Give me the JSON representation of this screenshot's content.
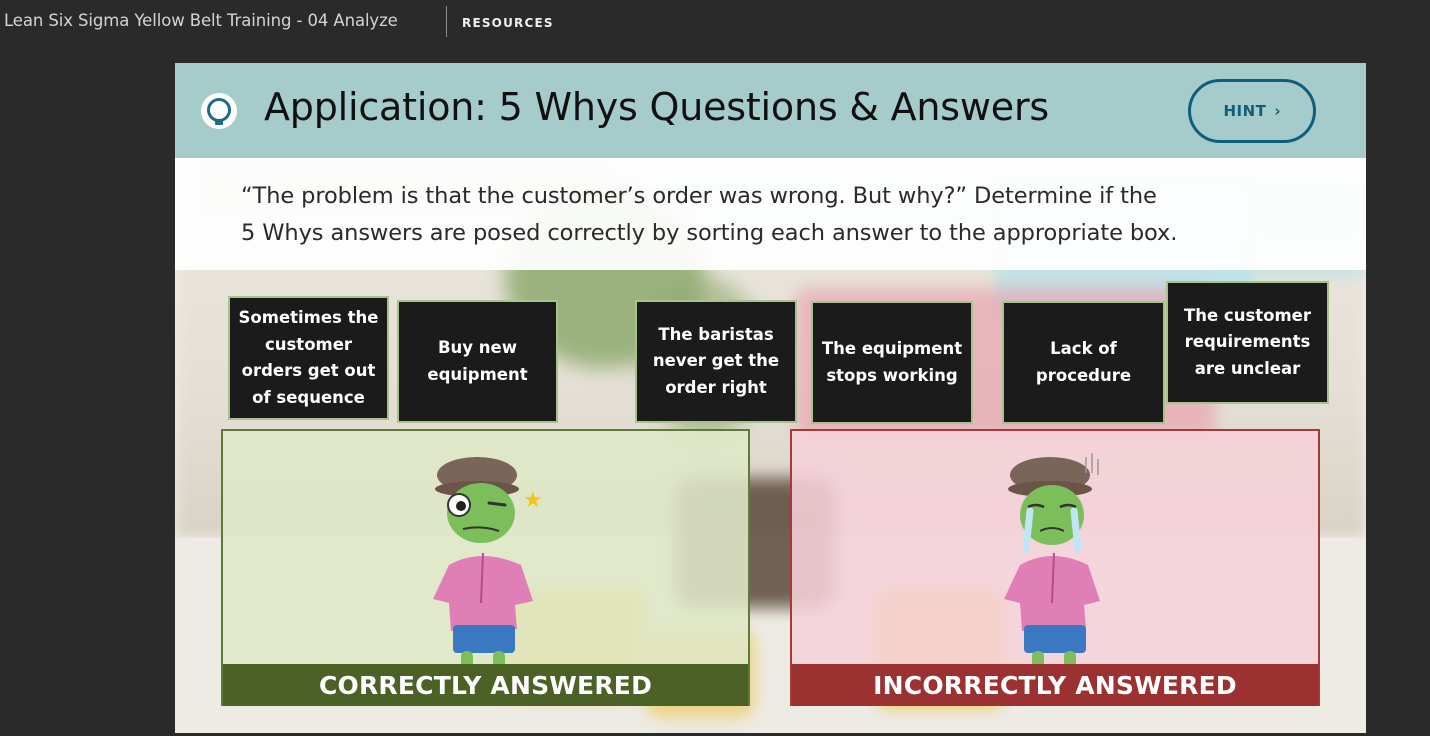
{
  "topbar": {
    "course_title": "Lean Six Sigma Yellow Belt Training - 04 Analyze",
    "resources_label": "RESOURCES"
  },
  "slide": {
    "title": "Application: 5 Whys Questions & Answers",
    "hint_label": "HINT",
    "hint_icon": "chevron-right-icon",
    "title_icon": "lightbulb-icon",
    "instruction_line1": "“The problem is that the customer’s order was wrong. But why?” Determine if the",
    "instruction_line2": "5 Whys answers are posed correctly by sorting each answer to the appropriate box.",
    "cards": [
      {
        "label": "Sometimes the customer orders get out of sequence"
      },
      {
        "label": "Buy new equipment"
      },
      {
        "label": "The baristas never get the order right"
      },
      {
        "label": "The equipment stops working"
      },
      {
        "label": "Lack of procedure"
      },
      {
        "label": "The customer requirements are unclear"
      }
    ],
    "zones": {
      "correct_label": "CORRECTLY ANSWERED",
      "incorrect_label": "INCORRECTLY ANSWERED"
    }
  },
  "colors": {
    "header_bg": "#a5cbcb",
    "hint_accent": "#0f5f7a",
    "card_bg": "#1b1b1b",
    "card_border": "#a7c28a",
    "correct_bar": "#4c6126",
    "incorrect_bar": "#9c3131"
  }
}
